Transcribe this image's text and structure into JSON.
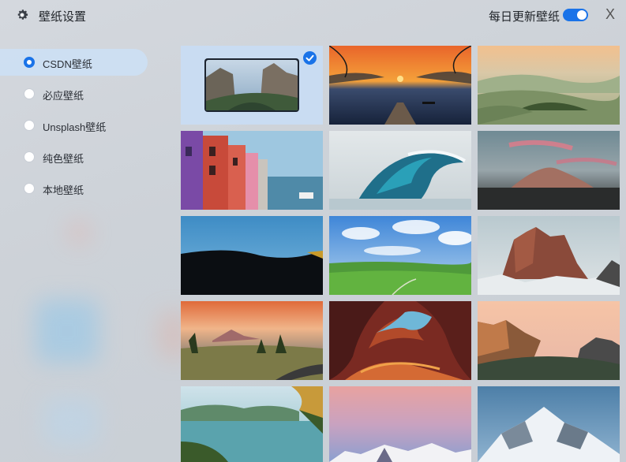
{
  "header": {
    "title": "壁纸设置",
    "gear_icon": "gear-icon",
    "daily_update_label": "每日更新壁纸",
    "daily_update_enabled": true,
    "close_label": "X"
  },
  "sidebar": {
    "items": [
      {
        "label": "CSDN壁纸",
        "selected": true
      },
      {
        "label": "必应壁纸",
        "selected": false
      },
      {
        "label": "Unsplash壁纸",
        "selected": false
      },
      {
        "label": "纯色壁纸",
        "selected": false
      },
      {
        "label": "本地壁纸",
        "selected": false
      }
    ]
  },
  "wallpapers": [
    {
      "theme": "yosemite-valley-thumbnail",
      "selected": true
    },
    {
      "theme": "sunset-lake-pier"
    },
    {
      "theme": "misty-green-hills"
    },
    {
      "theme": "colorful-houses-canal"
    },
    {
      "theme": "ocean-wave"
    },
    {
      "theme": "pink-sky-mountain"
    },
    {
      "theme": "dark-hill-silhouette"
    },
    {
      "theme": "green-meadow-blue-sky"
    },
    {
      "theme": "rocky-peaks-snow"
    },
    {
      "theme": "road-autumn-trees"
    },
    {
      "theme": "antelope-canyon"
    },
    {
      "theme": "yosemite-dusk"
    },
    {
      "theme": "turquoise-lake"
    },
    {
      "theme": "pastel-sky-snow-peaks"
    },
    {
      "theme": "snowy-mountain-blue-sky"
    }
  ]
}
